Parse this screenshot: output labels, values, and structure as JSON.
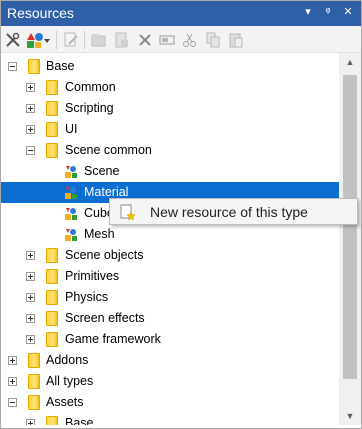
{
  "window": {
    "title": "Resources",
    "buttons": [
      "▾",
      "ᵠ",
      "✕"
    ]
  },
  "toolbar": {
    "icons": [
      "tools-icon",
      "new-resource-icon",
      "edit-icon",
      "new-folder-icon",
      "import-icon",
      "delete-icon",
      "rename-icon",
      "cut-icon",
      "copy-icon",
      "paste-icon"
    ]
  },
  "tree": {
    "items": [
      {
        "label": "Base",
        "type": "folder",
        "level": 0,
        "expander": "minus"
      },
      {
        "label": "Common",
        "type": "folder",
        "level": 1,
        "expander": "plus"
      },
      {
        "label": "Scripting",
        "type": "folder",
        "level": 1,
        "expander": "plus"
      },
      {
        "label": "UI",
        "type": "folder",
        "level": 1,
        "expander": "plus"
      },
      {
        "label": "Scene common",
        "type": "folder",
        "level": 1,
        "expander": "minus"
      },
      {
        "label": "Scene",
        "type": "resource",
        "level": 2
      },
      {
        "label": "Material",
        "type": "resource",
        "level": 2,
        "selected": true
      },
      {
        "label": "Cubemap",
        "type": "resource",
        "level": 2
      },
      {
        "label": "Mesh",
        "type": "resource",
        "level": 2
      },
      {
        "label": "Scene objects",
        "type": "folder",
        "level": 1,
        "expander": "plus"
      },
      {
        "label": "Primitives",
        "type": "folder",
        "level": 1,
        "expander": "plus"
      },
      {
        "label": "Physics",
        "type": "folder",
        "level": 1,
        "expander": "plus"
      },
      {
        "label": "Screen effects",
        "type": "folder",
        "level": 1,
        "expander": "plus"
      },
      {
        "label": "Game framework",
        "type": "folder",
        "level": 1,
        "expander": "plus"
      },
      {
        "label": "Addons",
        "type": "folder",
        "level": 0,
        "expander": "plus"
      },
      {
        "label": "All types",
        "type": "folder",
        "level": 0,
        "expander": "plus"
      },
      {
        "label": "Assets",
        "type": "folder",
        "level": 0,
        "expander": "minus"
      },
      {
        "label": "Base",
        "type": "folder",
        "level": 1,
        "expander": "plus"
      }
    ]
  },
  "context_menu": {
    "items": [
      {
        "label": "New resource of this type",
        "icon": "new-resource-icon"
      }
    ]
  },
  "colors": {
    "titlebar": "#2f5fa7",
    "selection": "#0a6ed1",
    "folder": "#ffd23d"
  }
}
